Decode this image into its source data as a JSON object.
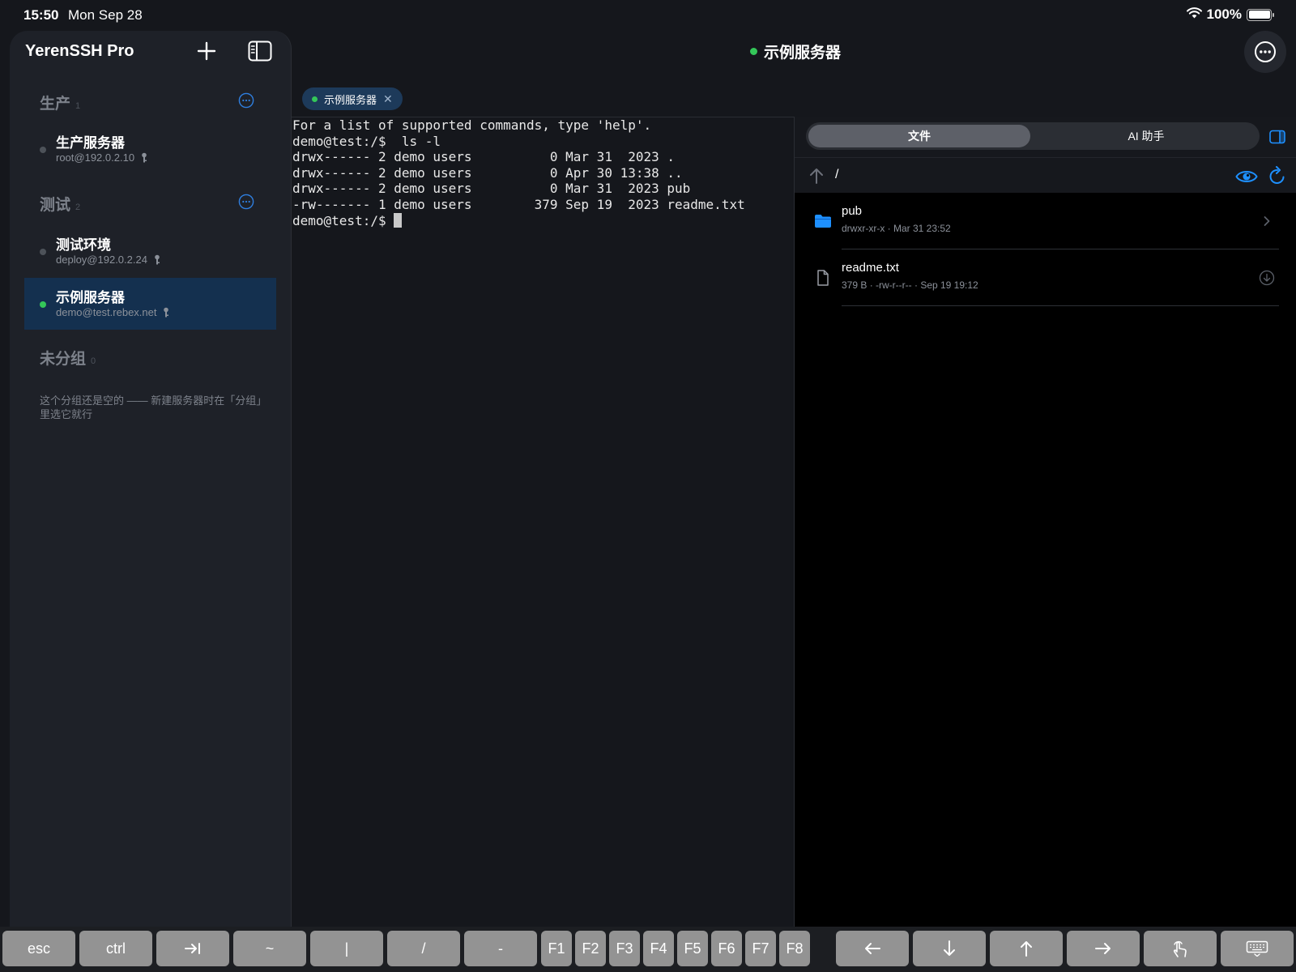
{
  "status": {
    "time": "15:50",
    "date": "Mon Sep 28",
    "battery": "100%",
    "battery_level": 1.0
  },
  "sidebar": {
    "title": "YerenSSH Pro",
    "groups": [
      {
        "name": "生产",
        "count": "1"
      },
      {
        "name": "测试",
        "count": "2"
      },
      {
        "name": "未分组",
        "count": "0",
        "empty_hint": "这个分组还是空的 —— 新建服务器时在「分组」里选它就行"
      }
    ],
    "servers": [
      {
        "name": "生产服务器",
        "address": "root@192.0.2.10",
        "connected": false
      },
      {
        "name": "测试环境",
        "address": "deploy@192.0.2.24",
        "connected": false
      },
      {
        "name": "示例服务器",
        "address": "demo@test.rebex.net",
        "connected": true
      }
    ]
  },
  "header": {
    "title": "示例服务器"
  },
  "session_tab": {
    "label": "示例服务器",
    "close": "✕"
  },
  "terminal": {
    "lines": [
      "For a list of supported commands, type 'help'.",
      "demo@test:/$  ls -l",
      "drwx------ 2 demo users          0 Mar 31  2023 .",
      "drwx------ 2 demo users          0 Apr 30 13:38 ..",
      "drwx------ 2 demo users          0 Mar 31  2023 pub",
      "-rw------- 1 demo users        379 Sep 19  2023 readme.txt"
    ],
    "prompt": "demo@test:/$ "
  },
  "files_panel": {
    "tabs": [
      "文件",
      "AI 助手"
    ],
    "path": "/",
    "entries": [
      {
        "name": "pub",
        "meta": "drwxr-xr-x · Mar 31 23:52",
        "type": "folder"
      },
      {
        "name": "readme.txt",
        "meta": "379 B · -rw-r--r-- · Sep 19 19:12",
        "type": "file"
      }
    ]
  },
  "keybar": {
    "keys": [
      "esc",
      "ctrl",
      "tab-icon",
      "~",
      "|",
      "/",
      "-",
      "F1",
      "F2",
      "F3",
      "F4",
      "F5",
      "F6",
      "F7",
      "F8",
      "left-arrow-icon",
      "down-arrow-icon",
      "up-arrow-icon",
      "right-arrow-icon",
      "touch-icon",
      "keyboard-icon"
    ],
    "labels": {
      "esc": "esc",
      "ctrl": "ctrl",
      "tilde": "~",
      "pipe": "|",
      "slash": "/",
      "dash": "-",
      "f1": "F1",
      "f2": "F2",
      "f3": "F3",
      "f4": "F4",
      "f5": "F5",
      "f6": "F6",
      "f7": "F7",
      "f8": "F8"
    }
  },
  "colors": {
    "accent": "#1e90ff",
    "online": "#34c759",
    "selected_bg": "#14304f"
  }
}
